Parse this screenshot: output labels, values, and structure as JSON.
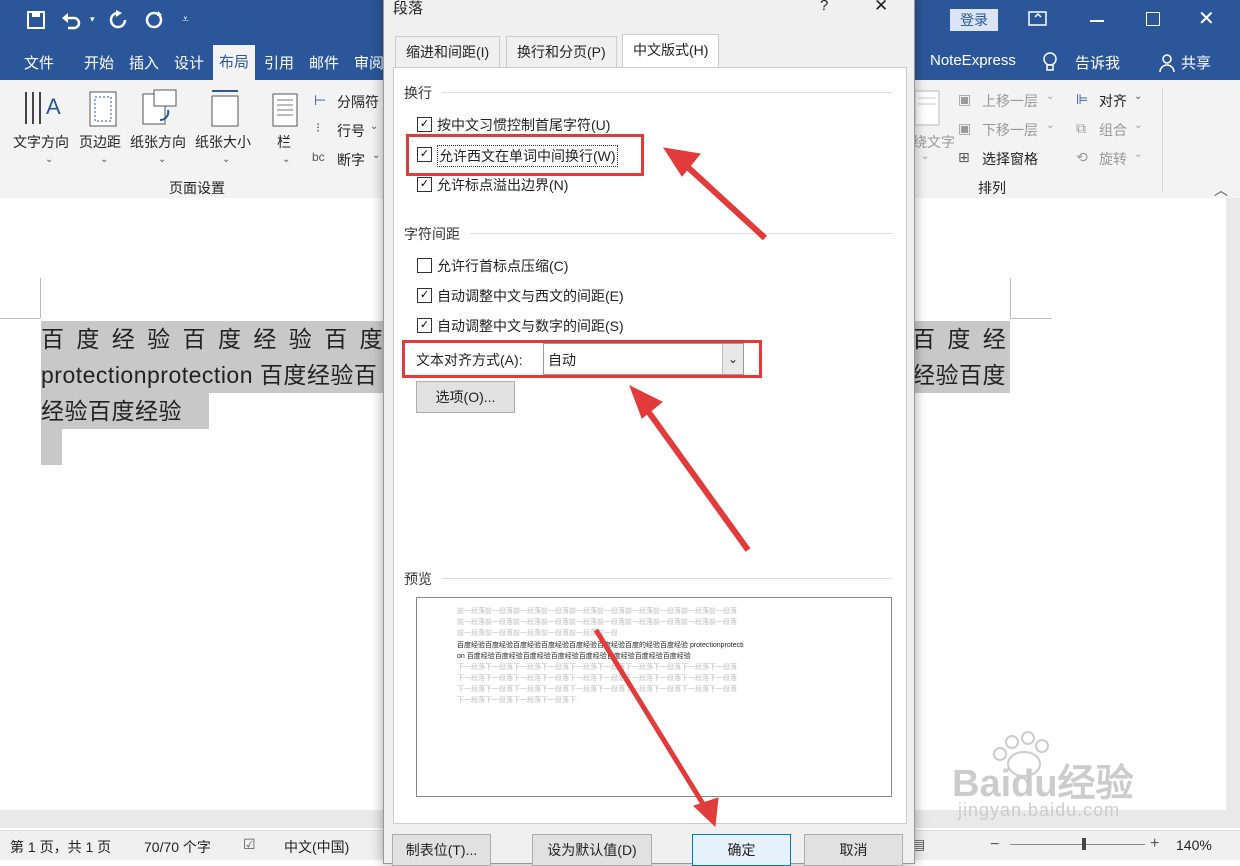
{
  "titlebar": {
    "login": "登录",
    "qa_icons": [
      "save-icon",
      "undo-icon",
      "redo-icon",
      "refresh-icon",
      "customize-icon"
    ]
  },
  "menu": {
    "file": "文件",
    "home": "开始",
    "insert": "插入",
    "design": "设计",
    "layout": "布局",
    "references": "引用",
    "mail": "邮件",
    "review": "审阅",
    "noteexpress": "NoteExpress",
    "tellme": "告诉我",
    "share": "共享"
  },
  "ribbon": {
    "text_direction": "文字方向",
    "margins": "页边距",
    "orientation": "纸张方向",
    "size": "纸张大小",
    "columns": "栏",
    "breaks": "分隔符",
    "line_numbers": "行号",
    "hyphenation": "断字",
    "group_page_setup": "页面设置",
    "wrap_text": "绕文字",
    "bring_forward": "上移一层",
    "send_backward": "下移一层",
    "selection_pane": "选择窗格",
    "align": "对齐",
    "group": "组合",
    "rotate": "旋转",
    "group_arrange": "排列"
  },
  "document": {
    "line1_left": "百 度 经 验 百 度 经 验 百 度 经 验",
    "line1_right": "百 度 经 验",
    "line2_left": "protectionprotection  百度经验百",
    "line2_right": "经验百度",
    "line3": "经验百度经验"
  },
  "status": {
    "page": "第 1 页，共 1 页",
    "words": "70/70 个字",
    "language": "中文(中国)",
    "zoom": "140%"
  },
  "dialog": {
    "title": "段落",
    "help": "?",
    "close": "✕",
    "tabs": [
      "缩进和间距(I)",
      "换行和分页(P)",
      "中文版式(H)"
    ],
    "section_line_break": "换行",
    "cb1": "按中文习惯控制首尾字符(U)",
    "cb2": "允许西文在单词中间换行(W)",
    "cb3": "允许标点溢出边界(N)",
    "section_char_spacing": "字符间距",
    "cb4": "允许行首标点压缩(C)",
    "cb5": "自动调整中文与西文的间距(E)",
    "cb6": "自动调整中文与数字的间距(S)",
    "align_label": "文本对齐方式(A):",
    "align_value": "自动",
    "options_button": "选项(O)...",
    "section_preview": "预览",
    "preview_prev": "前一段落前一段落前一段落前一段落前一段落前一段落前一段落前一段落前一段落前一段落",
    "preview_main1": "百度经验百度经验百度经验百度经验百度经验百度经验百度的经验百度经验  protectionprotecti",
    "preview_main2": "on 百度经验百度经验百度经验百度经验百度经验百度经验百度经验百度经验",
    "preview_next": "下一段落下一段落下一段落下一段落下一段落下一段落下一段落下一段落下一段落下一段落",
    "tabs_button": "制表位(T)...",
    "default_button": "设为默认值(D)",
    "ok_button": "确定",
    "cancel_button": "取消"
  },
  "watermark": {
    "brand": "Baidu经验",
    "url": "jingyan.baidu.com"
  },
  "colors": {
    "accent": "#2b579a",
    "highlight": "#e23b3b"
  }
}
